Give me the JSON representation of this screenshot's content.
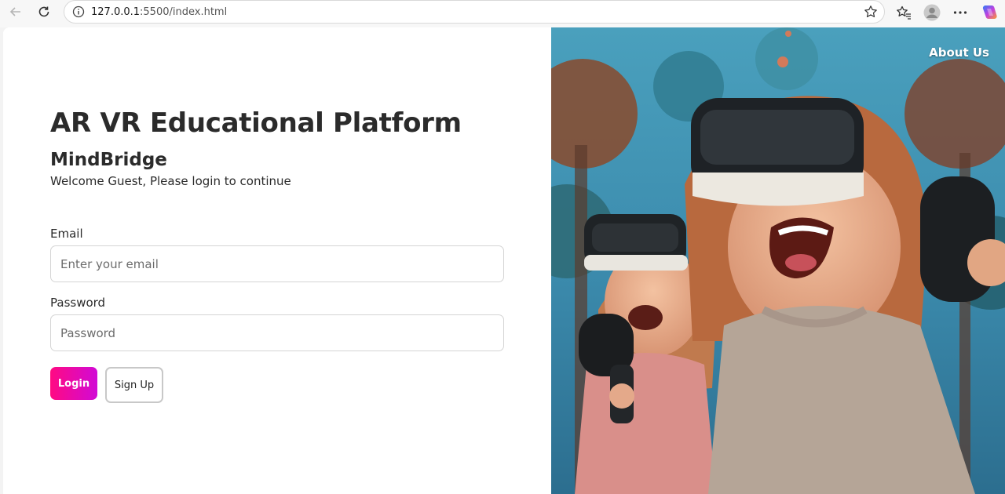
{
  "browser": {
    "url_host": "127.0.0.1",
    "url_path": ":5500/index.html"
  },
  "page": {
    "title": "AR VR Educational Platform",
    "brand": "MindBridge",
    "welcome": "Welcome Guest, Please login to continue",
    "nav_about": "About Us"
  },
  "form": {
    "email_label": "Email",
    "email_placeholder": "Enter your email",
    "email_value": "",
    "password_label": "Password",
    "password_placeholder": "Password",
    "password_value": "",
    "login_label": "Login",
    "signup_label": "Sign Up"
  },
  "colors": {
    "login_gradient_start": "#ff0a82",
    "login_gradient_end": "#d10ad6",
    "hero_bg": "#3f8fb2"
  },
  "icons": {
    "back": "back-arrow-icon",
    "reload": "reload-icon",
    "site_info": "info-icon",
    "favorite": "star-icon",
    "favorites_bar": "favorites-icon",
    "profile": "profile-icon",
    "more": "more-icon",
    "copilot": "copilot-icon"
  },
  "hero_image": {
    "alt": ""
  }
}
